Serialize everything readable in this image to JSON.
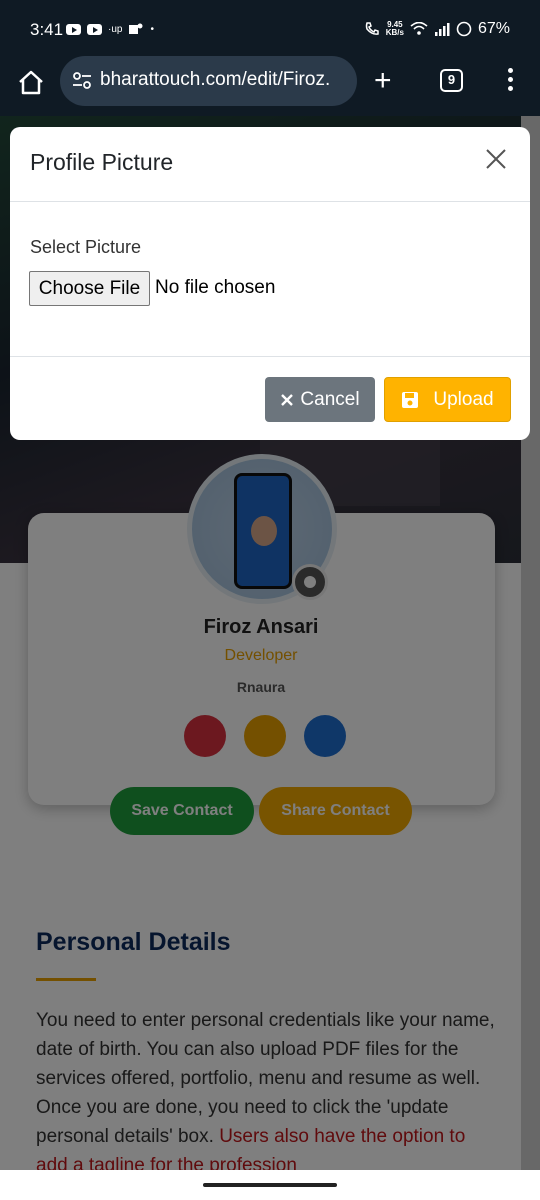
{
  "status_bar": {
    "time": "3:41",
    "up_indicator": "·up",
    "dot": "•",
    "speed_value": "9.45",
    "speed_unit": "KB/s",
    "battery": "67%"
  },
  "browser": {
    "url": "bharattouch.com/edit/Firoz.",
    "tab_count": "9"
  },
  "modal": {
    "title": "Profile Picture",
    "field_label": "Select Picture",
    "file_button": "Choose File",
    "file_status": "No file chosen",
    "cancel_label": "Cancel",
    "upload_label": "Upload"
  },
  "profile": {
    "name": "Firoz Ansari",
    "role": "Developer",
    "company": "Rnaura",
    "save_button": "Save Contact",
    "share_button": "Share Contact"
  },
  "personal_details": {
    "title": "Personal Details",
    "text_main": "You need to enter personal credentials like your name, date of birth. You can also upload PDF files for the services offered, portfolio, menu and resume as well. Once you are done, you need to click the 'update personal details' box. ",
    "text_highlight": "Users also have the option to add a tagline for the profession"
  },
  "colors": {
    "accent_yellow": "#ffb300",
    "cancel_gray": "#6c757d",
    "save_green": "#1e9e3c",
    "title_navy": "#0d2a5c"
  }
}
